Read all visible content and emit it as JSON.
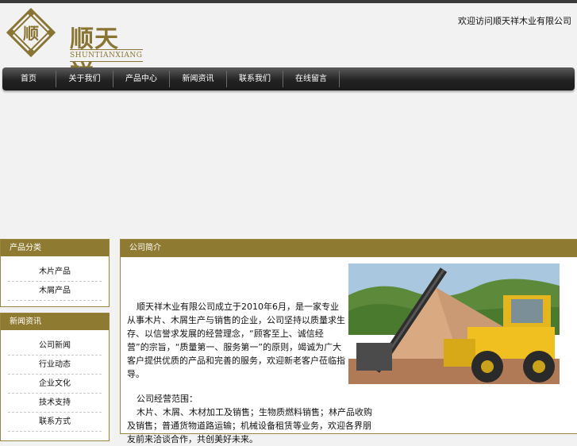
{
  "brand": {
    "name": "顺天祥",
    "latin": "SHUNTIANXIANG",
    "mark": "顺"
  },
  "top_right_text": "欢迎访问顺天祥木业有限公司",
  "nav": [
    "首页",
    "关于我们",
    "产品中心",
    "新闻资讯",
    "联系我们",
    "在线留言"
  ],
  "side_boxes": [
    {
      "title": "产品分类",
      "items": [
        "木片产品",
        "木屑产品"
      ]
    },
    {
      "title": "新闻资讯",
      "items": [
        "公司新闻",
        "行业动态",
        "企业文化",
        "技术支持",
        "联系方式"
      ]
    }
  ],
  "main": {
    "title": "公司简介",
    "intro": "顺天祥木业有限公司成立于2010年6月，是一家专业从事木片、木屑生产与销售的企业，公司坚持以质量求生存、以信誉求发展的经营理念，“顾客至上、诚信经营”的宗旨，“质量第一、服务第一”的原则，竭诚为广大客户提供优质的产品和完善的服务，欢迎新老客户莅临指导。",
    "heading2": "公司经营范围：",
    "detail": "木片、木屑、木材加工及销售；生物质燃料销售；林产品收购及销售；普通货物道路运输；机械设备租赁等业务，欢迎各界朋友前来洽谈合作，共创美好未来。"
  },
  "colors": {
    "gold": "#8f7a32",
    "nav_dark": "#1a1a1a"
  }
}
